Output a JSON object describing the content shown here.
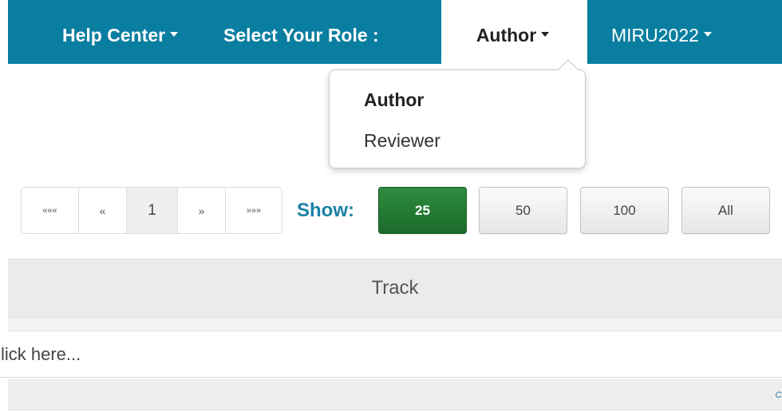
{
  "navbar": {
    "help_center": "Help Center",
    "select_role_label": "Select Your Role :",
    "current_role": "Author",
    "event": "MIRU2022"
  },
  "role_menu": {
    "items": [
      "Author",
      "Reviewer"
    ],
    "selected": "Author"
  },
  "pagination": {
    "first": "«««",
    "prev": "«",
    "current_page": "1",
    "next": "»",
    "last": "»»»"
  },
  "page_size": {
    "label": "Show:",
    "options": [
      "25",
      "50",
      "100",
      "All"
    ],
    "selected": "25"
  },
  "table": {
    "column_header": "Track",
    "filter_placeholder": "click here...",
    "clear_link": "Cle"
  },
  "colors": {
    "navbar": "#0a7ea0",
    "active_button": "#2e8b3e",
    "show_label": "#1b81a6"
  }
}
